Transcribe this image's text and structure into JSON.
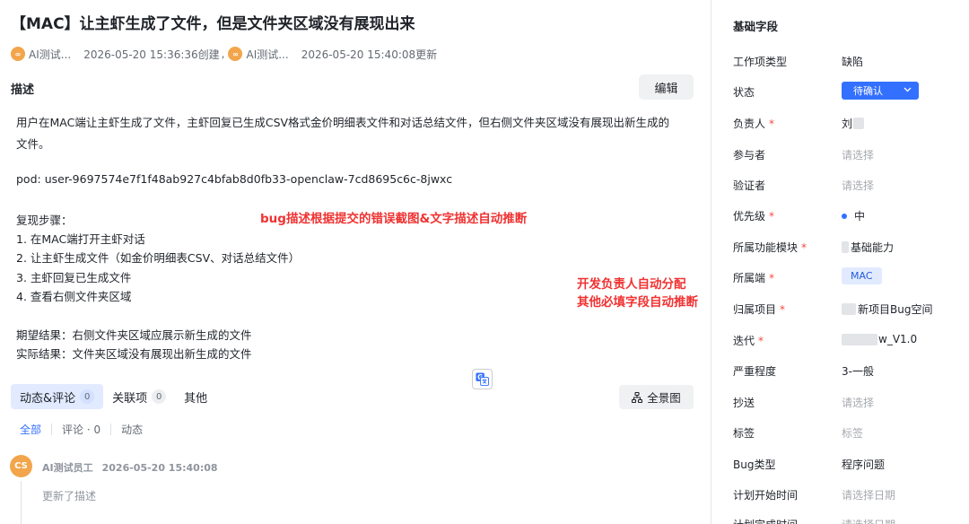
{
  "issue": {
    "title": "【MAC】让主虾生成了文件，但是文件夹区域没有展现出来",
    "creator_name": "AI测试...",
    "creator_avatar": "∞",
    "created_text": "2026-05-20 15:36:36创建",
    "separator": ",",
    "updater_name": "AI测试...",
    "updater_avatar": "∞",
    "updated_text": "2026-05-20 15:40:08更新"
  },
  "description": {
    "label": "描述",
    "edit_label": "编辑",
    "lines": [
      "用户在MAC端让主虾生成了文件，主虾回复已生成CSV格式金价明细表文件和对话总结文件，但右侧文件夹区域没有展现出新生成的",
      "文件。",
      "pod: user-9697574e7f1f48ab927c4bfab8d0fb33-openclaw-7cd8695c6c-8jwxc",
      "复现步骤：",
      "1. 在MAC端打开主虾对话",
      "2. 让主虾生成文件（如金价明细表CSV、对话总结文件）",
      "3. 主虾回复已生成文件",
      "4. 查看右侧文件夹区域",
      "期望结果：右侧文件夹区域应展示新生成的文件",
      "实际结果：文件夹区域没有展现出新生成的文件"
    ]
  },
  "annotations": {
    "bug_desc": "bug描述根据提交的错误截图&文字描述自动推断",
    "assign_line1": "开发负责人自动分配",
    "assign_line2": "其他必填字段自动推断"
  },
  "tabs": [
    {
      "label": "动态&评论",
      "count": "0"
    },
    {
      "label": "关联项",
      "count": "0"
    },
    {
      "label": "其他"
    }
  ],
  "overview_label": "全景图",
  "filters": [
    "全部",
    "评论 · 0",
    "动态"
  ],
  "activity": {
    "avatar": "CS",
    "author": "AI测试员工",
    "time": "2026-05-20 15:40:08",
    "text": "更新了描述"
  },
  "sidebar": {
    "title": "基础字段",
    "fields": [
      {
        "label": "工作项类型",
        "value": "缺陷"
      },
      {
        "label": "状态",
        "value": "待确认"
      },
      {
        "label": "负责人",
        "value": "刘",
        "required": "*"
      },
      {
        "label": "参与者",
        "value": "请选择"
      },
      {
        "label": "验证者",
        "value": "请选择"
      },
      {
        "label": "优先级",
        "value": "中",
        "required": "*"
      },
      {
        "label": "所属功能模块",
        "value": "基础能力",
        "required": "*"
      },
      {
        "label": "所属端",
        "value": "MAC",
        "required": "*"
      },
      {
        "label": "归属项目",
        "value": "新项目Bug空间",
        "required": "*"
      },
      {
        "label": "迭代",
        "value": "w_V1.0",
        "required": "*"
      },
      {
        "label": "严重程度",
        "value": "3-一般"
      },
      {
        "label": "抄送",
        "value": "请选择"
      },
      {
        "label": "标签",
        "value": "标签"
      },
      {
        "label": "Bug类型",
        "value": "程序问题"
      },
      {
        "label": "计划开始时间",
        "value": "请选择日期"
      },
      {
        "label": "计划完成时间",
        "value": "请选择日期"
      }
    ]
  },
  "colors": {
    "primary": "#3370ff",
    "annotation": "#f03232",
    "avatar": "#f2a54a",
    "required": "#f54a45"
  }
}
